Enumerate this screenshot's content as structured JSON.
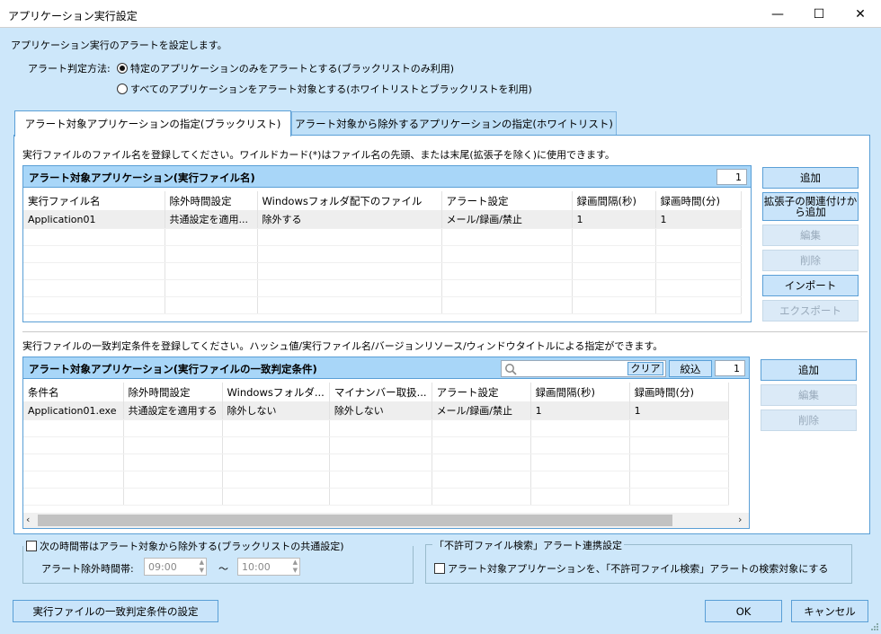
{
  "window": {
    "title": "アプリケーション実行設定",
    "minimize": "—",
    "maximize": "☐",
    "close": "✕"
  },
  "intro": "アプリケーション実行のアラートを設定します。",
  "judge": {
    "label": "アラート判定方法:",
    "option1": "特定のアプリケーションのみをアラートとする(ブラックリストのみ利用)",
    "option2": "すべてのアプリケーションをアラート対象とする(ホワイトリストとブラックリストを利用)",
    "selected": 1
  },
  "tabs": [
    {
      "label": "アラート対象アプリケーションの指定(ブラックリスト)"
    },
    {
      "label": "アラート対象から除外するアプリケーションの指定(ホワイトリスト)"
    }
  ],
  "blacklist": {
    "instruction": "実行ファイルのファイル名を登録してください。ワイルドカード(*)はファイル名の先頭、または末尾(拡張子を除く)に使用できます。",
    "title": "アラート対象アプリケーション(実行ファイル名)",
    "count": "1",
    "columns": [
      "実行ファイル名",
      "除外時間設定",
      "Windowsフォルダ配下のファイル",
      "アラート設定",
      "録画間隔(秒)",
      "録画時間(分)"
    ],
    "rows": [
      [
        "Application01",
        "共通設定を適用...",
        "除外する",
        "メール/録画/禁止",
        "1",
        "1"
      ]
    ],
    "buttons": {
      "add": "追加",
      "assoc": "拡張子の関連付けから追加",
      "edit": "編集",
      "delete": "削除",
      "import": "インポート",
      "export": "エクスポート"
    }
  },
  "condition": {
    "instruction": "実行ファイルの一致判定条件を登録してください。ハッシュ値/実行ファイル名/バージョンリソース/ウィンドウタイトルによる指定ができます。",
    "title": "アラート対象アプリケーション(実行ファイルの一致判定条件)",
    "search_value": "",
    "clear": "クリア",
    "filter": "絞込",
    "count": "1",
    "columns": [
      "条件名",
      "除外時間設定",
      "Windowsフォルダ...",
      "マイナンバー取扱...",
      "アラート設定",
      "録画間隔(秒)",
      "録画時間(分)"
    ],
    "rows": [
      [
        "Application01.exe",
        "共通設定を適用する",
        "除外しない",
        "除外しない",
        "メール/録画/禁止",
        "1",
        "1"
      ]
    ],
    "buttons": {
      "add": "追加",
      "edit": "編集",
      "delete": "削除"
    }
  },
  "exclude_time": {
    "checkbox": "次の時間帯はアラート対象から除外する(ブラックリストの共通設定)",
    "label": "アラート除外時間帯:",
    "from": "09:00",
    "tilde": "〜",
    "to": "10:00"
  },
  "forbidden": {
    "legend": "「不許可ファイル検索」アラート連携設定",
    "checkbox": "アラート対象アプリケーションを、「不許可ファイル検索」アラートの検索対象にする"
  },
  "footer": {
    "match_settings": "実行ファイルの一致判定条件の設定",
    "ok": "OK",
    "cancel": "キャンセル"
  }
}
